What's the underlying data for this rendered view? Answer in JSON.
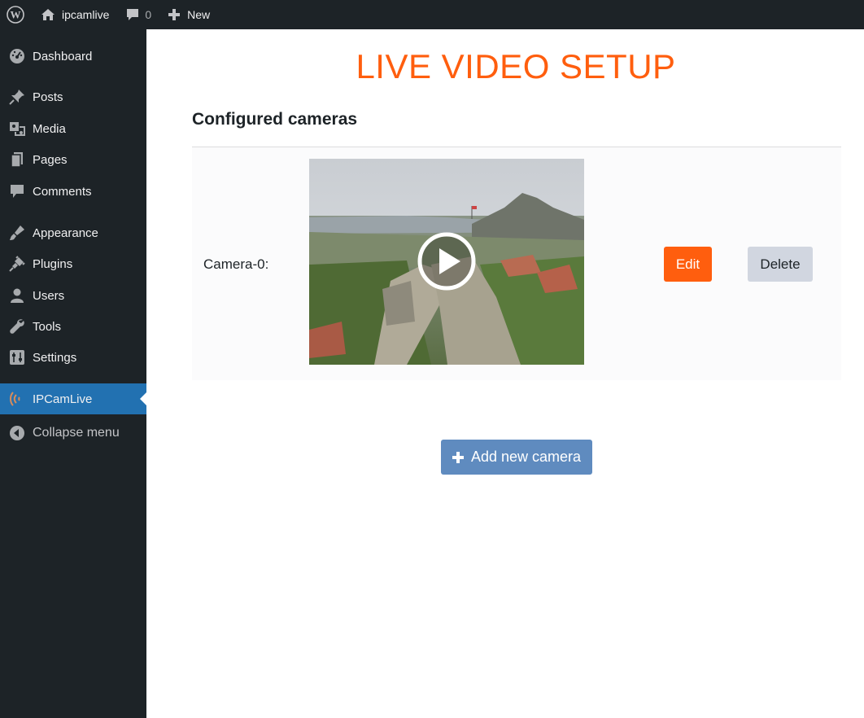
{
  "admin_bar": {
    "site_name": "ipcamlive",
    "comments_count": "0",
    "new_label": "New"
  },
  "sidebar": {
    "items": [
      {
        "label": "Dashboard",
        "icon": "dashboard-icon"
      },
      {
        "label": "Posts",
        "icon": "pin-icon"
      },
      {
        "label": "Media",
        "icon": "media-icon"
      },
      {
        "label": "Pages",
        "icon": "pages-icon"
      },
      {
        "label": "Comments",
        "icon": "comment-icon"
      },
      {
        "label": "Appearance",
        "icon": "brush-icon"
      },
      {
        "label": "Plugins",
        "icon": "plugin-icon"
      },
      {
        "label": "Users",
        "icon": "user-icon"
      },
      {
        "label": "Tools",
        "icon": "wrench-icon"
      },
      {
        "label": "Settings",
        "icon": "settings-icon"
      },
      {
        "label": "IPCamLive",
        "icon": "broadcast-icon"
      }
    ],
    "collapse_label": "Collapse menu"
  },
  "main": {
    "title": "LIVE VIDEO SETUP",
    "section_title": "Configured cameras",
    "cameras": [
      {
        "label": "Camera-0:",
        "edit_label": "Edit",
        "delete_label": "Delete"
      }
    ],
    "add_button_label": "Add new camera"
  },
  "colors": {
    "title": "#ff5e0e",
    "edit_button": "#ff5e0e",
    "delete_button": "#d1d6e0",
    "add_button": "#5f8bbf",
    "sidebar_bg": "#1d2327",
    "active_menu": "#2271b1"
  }
}
